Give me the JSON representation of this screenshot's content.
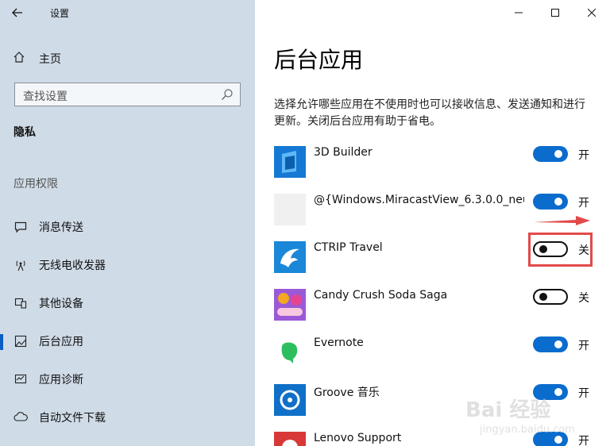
{
  "window": {
    "title": "设置"
  },
  "sidebar": {
    "home_label": "主页",
    "search_placeholder": "查找设置",
    "section_title": "隐私",
    "group_title": "应用权限",
    "items": [
      {
        "label": "消息传送",
        "icon": "message-icon"
      },
      {
        "label": "无线电收发器",
        "icon": "radio-tower-icon"
      },
      {
        "label": "其他设备",
        "icon": "devices-icon"
      },
      {
        "label": "后台应用",
        "icon": "background-apps-icon",
        "active": true
      },
      {
        "label": "应用诊断",
        "icon": "diagnostics-icon"
      },
      {
        "label": "自动文件下载",
        "icon": "cloud-download-icon"
      }
    ]
  },
  "main": {
    "title": "后台应用",
    "description": "选择允许哪些应用在不使用时也可以接收信息、发送通知和进行更新。关闭后台应用有助于省电。",
    "apps": [
      {
        "name": "3D Builder",
        "state": "开",
        "on": true
      },
      {
        "name": "@{Windows.MiracastView_6.3.0.0_neut…",
        "state": "开",
        "on": true
      },
      {
        "name": "CTRIP Travel",
        "state": "关",
        "on": false
      },
      {
        "name": "Candy Crush Soda Saga",
        "state": "关",
        "on": false
      },
      {
        "name": "Evernote",
        "state": "开",
        "on": true
      },
      {
        "name": "Groove 音乐",
        "state": "开",
        "on": true
      },
      {
        "name": "Lenovo Support",
        "state": "开",
        "on": true
      }
    ]
  },
  "watermark": {
    "main": "Bai 经验",
    "sub": "jingyan.baidu.com"
  },
  "colors": {
    "accent": "#0a6ccd",
    "sidebar_bg": "#cfdbe7",
    "annotation": "#e24a4a"
  }
}
